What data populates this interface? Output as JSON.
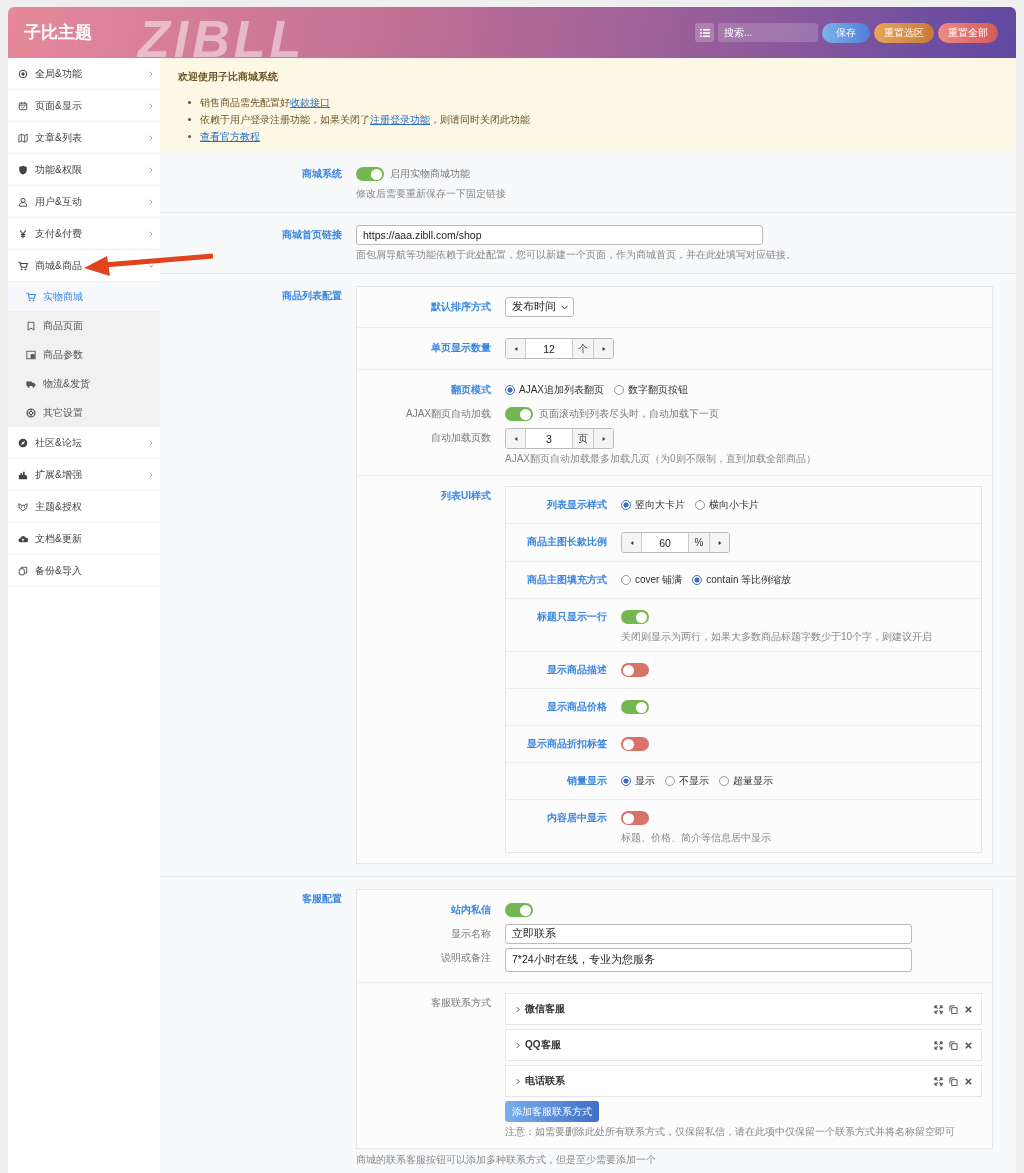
{
  "header": {
    "title": "子比主题",
    "watermark": "ZIBLL",
    "search": {
      "placeholder": "搜索..."
    },
    "buttons": [
      {
        "label": "保存",
        "kind": "save"
      },
      {
        "label": "重置选区",
        "kind": "reset-section"
      },
      {
        "label": "重置全部",
        "kind": "reset-all"
      }
    ]
  },
  "sidebar": {
    "items": [
      {
        "label": "全局&功能",
        "kind": "target",
        "submenu": true
      },
      {
        "label": "页面&显示",
        "kind": "calendar",
        "submenu": true
      },
      {
        "label": "文章&列表",
        "kind": "map",
        "submenu": true
      },
      {
        "label": "功能&权限",
        "kind": "shield",
        "submenu": true
      },
      {
        "label": "用户&互动",
        "kind": "user",
        "submenu": true
      },
      {
        "label": "支付&付费",
        "kind": "yen",
        "submenu": true
      },
      {
        "label": "商城&商品",
        "kind": "cart",
        "submenu": true,
        "expanded": true,
        "children": [
          {
            "label": "实物商城",
            "kind": "cart",
            "selected": true
          },
          {
            "label": "商品页面",
            "kind": "bookmark",
            "selected": false
          },
          {
            "label": "商品参数",
            "kind": "image",
            "selected": false
          },
          {
            "label": "物流&发货",
            "kind": "truck",
            "selected": false
          },
          {
            "label": "其它设置",
            "kind": "lifebuoy",
            "selected": false
          }
        ]
      },
      {
        "label": "社区&论坛",
        "kind": "compass",
        "submenu": true
      },
      {
        "label": "扩展&增强",
        "kind": "plug",
        "submenu": true
      },
      {
        "label": "主题&授权",
        "kind": "mask",
        "submenu": false
      },
      {
        "label": "文档&更新",
        "kind": "cloud",
        "submenu": false
      },
      {
        "label": "备份&导入",
        "kind": "copy",
        "submenu": false
      }
    ]
  },
  "notice": {
    "title": "欢迎使用子比商城系统",
    "items": [
      [
        {
          "text": "销售商品需先配置好",
          "link": false
        },
        {
          "text": "收款接口",
          "link": true
        }
      ],
      [
        {
          "text": "依赖于用户登录注册功能，如果关闭了",
          "link": false
        },
        {
          "text": "注册登录功能",
          "link": true
        },
        {
          "text": "，则请同时关闭此功能",
          "link": false
        }
      ],
      [
        {
          "text": "查看官方教程",
          "link": true
        }
      ]
    ]
  },
  "sections": [
    {
      "label": "商城系统",
      "fields": [
        {
          "kind": "switch",
          "on": true,
          "caption": "启用实物商城功能",
          "help": "修改后需要重新保存一下固定链接"
        }
      ]
    },
    {
      "label": "商城首页链接",
      "fields": [
        {
          "kind": "input",
          "value": "https://aaa.zibll.com/shop",
          "help": "面包屑导航等功能依赖于此处配置，您可以新建一个页面，作为商城首页，并在此处填写对应链接。"
        }
      ]
    },
    {
      "label": "商品列表配置",
      "fields": [
        {
          "kind": "group",
          "rows": [
            {
              "fields": [
                {
                  "kind": "select",
                  "label": "默认排序方式",
                  "value": "发布时间"
                }
              ]
            },
            {
              "fields": [
                {
                  "kind": "spinner",
                  "label": "单页显示数量",
                  "value": "12",
                  "unit": "个"
                }
              ]
            },
            {
              "fields": [
                {
                  "kind": "radio",
                  "label": "翻页模式",
                  "options": [
                    {
                      "label": "AJAX追加列表翻页",
                      "selected": true
                    },
                    {
                      "label": "数字翻页按钮",
                      "selected": false
                    }
                  ]
                },
                {
                  "kind": "switch",
                  "label": "AJAX翻页自动加载",
                  "on": true,
                  "caption": "页面滚动到列表尽头时，自动加载下一页"
                },
                {
                  "kind": "spinner",
                  "label": "自动加载页数",
                  "value": "3",
                  "unit": "页",
                  "help": "AJAX翻页自动加载最多加载几页（为0则不限制，直到加载全部商品）"
                }
              ]
            },
            {
              "fields": [
                {
                  "kind": "group",
                  "label": "列表UI样式",
                  "rows": [
                    {
                      "fields": [
                        {
                          "kind": "radio",
                          "label": "列表显示样式",
                          "options": [
                            {
                              "label": "竖向大卡片",
                              "selected": true
                            },
                            {
                              "label": "横向小卡片",
                              "selected": false
                            }
                          ]
                        }
                      ]
                    },
                    {
                      "fields": [
                        {
                          "kind": "spinner",
                          "label": "商品主图长款比例",
                          "value": "60",
                          "unit": "%"
                        }
                      ]
                    },
                    {
                      "fields": [
                        {
                          "kind": "radio",
                          "label": "商品主图填充方式",
                          "options": [
                            {
                              "label": "cover 铺满",
                              "selected": false
                            },
                            {
                              "label": "contain 等比例缩放",
                              "selected": true
                            }
                          ]
                        }
                      ]
                    },
                    {
                      "fields": [
                        {
                          "kind": "switch",
                          "label": "标题只显示一行",
                          "on": true,
                          "help": "关闭则显示为两行，如果大多数商品标题字数少于10个字，则建议开启"
                        }
                      ]
                    },
                    {
                      "fields": [
                        {
                          "kind": "switch",
                          "label": "显示商品描述",
                          "on": false
                        }
                      ]
                    },
                    {
                      "fields": [
                        {
                          "kind": "switch",
                          "label": "显示商品价格",
                          "on": true
                        }
                      ]
                    },
                    {
                      "fields": [
                        {
                          "kind": "switch",
                          "label": "显示商品折扣标签",
                          "on": false
                        }
                      ]
                    },
                    {
                      "fields": [
                        {
                          "kind": "radio",
                          "label": "销量显示",
                          "options": [
                            {
                              "label": "显示",
                              "selected": true
                            },
                            {
                              "label": "不显示",
                              "selected": false
                            },
                            {
                              "label": "超量显示",
                              "selected": false
                            }
                          ]
                        }
                      ]
                    },
                    {
                      "fields": [
                        {
                          "kind": "switch",
                          "label": "内容居中显示",
                          "on": false,
                          "help": "标题、价格、简介等信息居中显示"
                        }
                      ]
                    }
                  ]
                }
              ]
            }
          ]
        }
      ]
    },
    {
      "label": "客服配置",
      "fields": [
        {
          "kind": "group",
          "rows": [
            {
              "fields": [
                {
                  "kind": "switch",
                  "label": "站内私信",
                  "on": true
                },
                {
                  "kind": "input",
                  "label": "显示名称",
                  "value": "立即联系"
                },
                {
                  "kind": "textarea",
                  "label": "说明或备注",
                  "value": "7*24小时在线，专业为您服务"
                }
              ]
            },
            {
              "fields": [
                {
                  "kind": "repeater",
                  "label": "客服联系方式",
                  "items": [
                    "微信客服",
                    "QQ客服",
                    "电话联系"
                  ],
                  "button": "添加客服联系方式",
                  "help": "注意：如需要删除此处所有联系方式，仅保留私信，请在此项中仅保留一个联系方式并将名称留空即可"
                }
              ]
            }
          ]
        }
      ],
      "help": "商城的联系客服按钮可以添加多种联系方式，但是至少需要添加一个"
    }
  ]
}
